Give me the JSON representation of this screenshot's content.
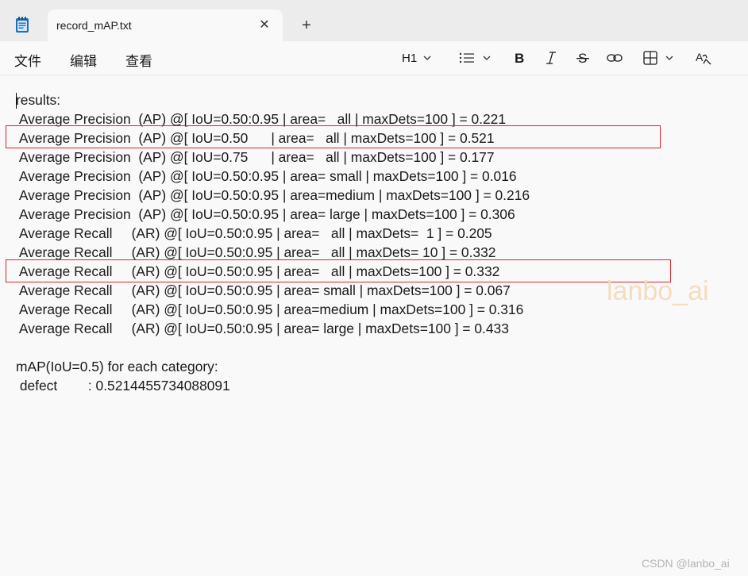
{
  "tab": {
    "title": "record_mAP.txt",
    "close_glyph": "✕",
    "new_glyph": "+"
  },
  "menu": {
    "file": "文件",
    "edit": "编辑",
    "view": "查看"
  },
  "toolbar": {
    "heading": "H1"
  },
  "document": {
    "lines": [
      "results:",
      " Average Precision  (AP) @[ IoU=0.50:0.95 | area=   all | maxDets=100 ] = 0.221",
      " Average Precision  (AP) @[ IoU=0.50      | area=   all | maxDets=100 ] = 0.521",
      " Average Precision  (AP) @[ IoU=0.75      | area=   all | maxDets=100 ] = 0.177",
      " Average Precision  (AP) @[ IoU=0.50:0.95 | area= small | maxDets=100 ] = 0.016",
      " Average Precision  (AP) @[ IoU=0.50:0.95 | area=medium | maxDets=100 ] = 0.216",
      " Average Precision  (AP) @[ IoU=0.50:0.95 | area= large | maxDets=100 ] = 0.306",
      " Average Recall     (AR) @[ IoU=0.50:0.95 | area=   all | maxDets=  1 ] = 0.205",
      " Average Recall     (AR) @[ IoU=0.50:0.95 | area=   all | maxDets= 10 ] = 0.332",
      " Average Recall     (AR) @[ IoU=0.50:0.95 | area=   all | maxDets=100 ] = 0.332",
      " Average Recall     (AR) @[ IoU=0.50:0.95 | area= small | maxDets=100 ] = 0.067",
      " Average Recall     (AR) @[ IoU=0.50:0.95 | area=medium | maxDets=100 ] = 0.316",
      " Average Recall     (AR) @[ IoU=0.50:0.95 | area= large | maxDets=100 ] = 0.433",
      "",
      "mAP(IoU=0.5) for each category:",
      " defect        : 0.5214455734088091"
    ]
  },
  "watermark": "lanbo_ai",
  "footer": {
    "credit": "CSDN @lanbo_ai"
  },
  "colors": {
    "highlight": "#d9242b",
    "watermark": "#f4dcbf"
  }
}
